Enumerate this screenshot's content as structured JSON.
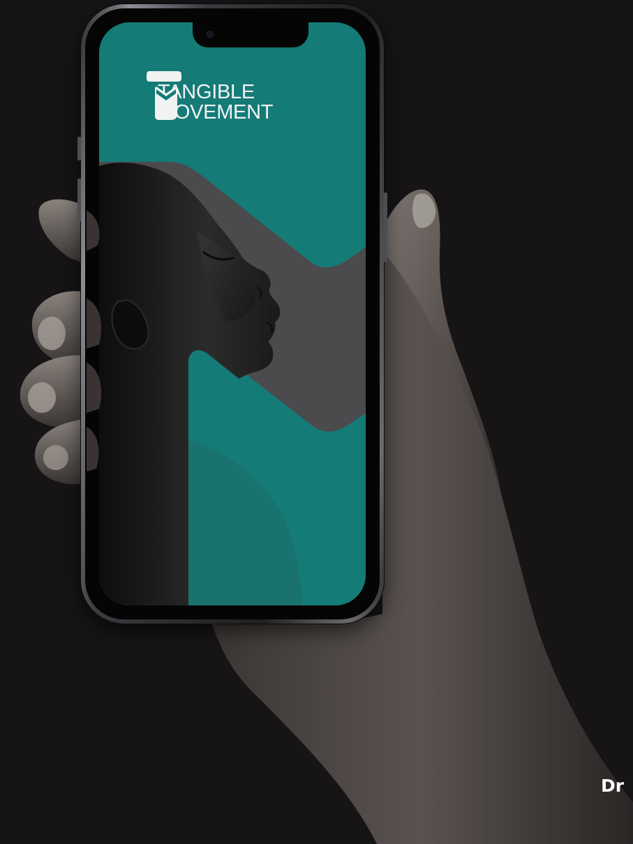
{
  "app": {
    "brand_line1": "TANGIBLE",
    "brand_line2": "MOVEMENT",
    "brand_icon": "tangible-movement-logo-icon"
  },
  "caption": {
    "partial_text": "Dr"
  },
  "colors": {
    "background": "#161415",
    "brand_teal": "#147b77",
    "shape_gray": "#4b4a4d",
    "text_light": "#f1f3f2"
  }
}
